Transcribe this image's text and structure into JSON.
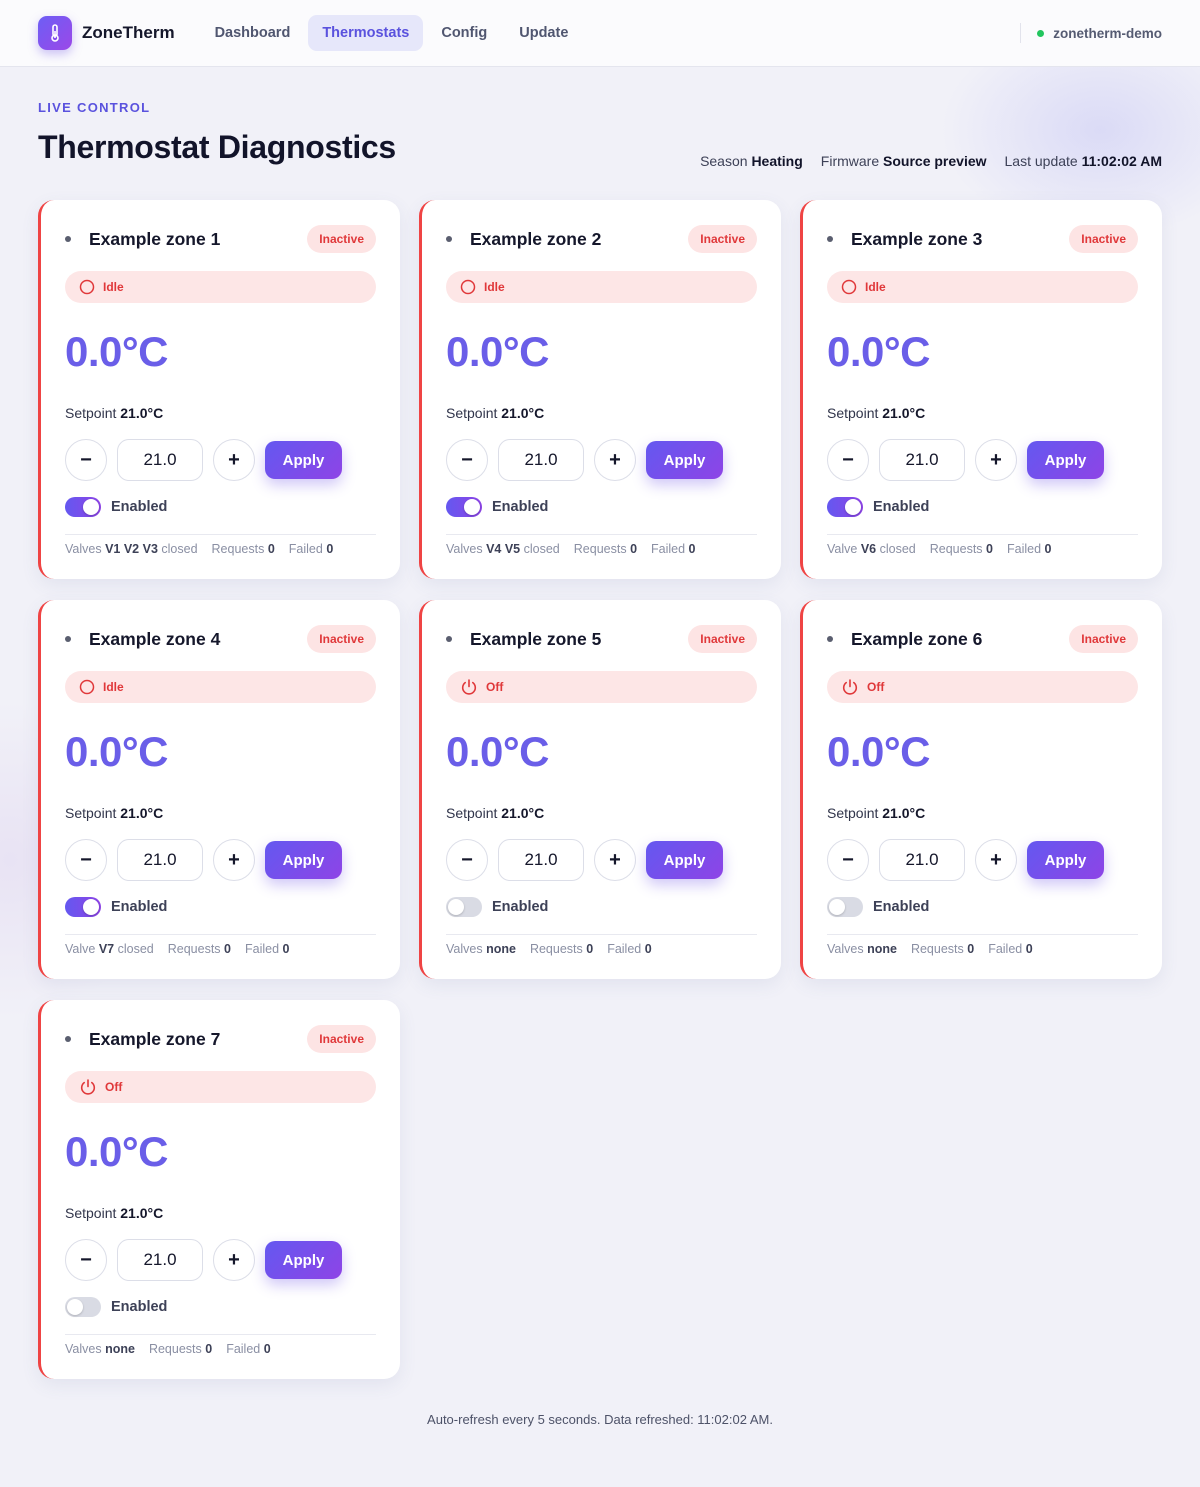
{
  "app": {
    "name": "ZoneTherm",
    "host": "zonetherm-demo"
  },
  "nav": [
    {
      "label": "Dashboard",
      "active": false
    },
    {
      "label": "Thermostats",
      "active": true
    },
    {
      "label": "Config",
      "active": false
    },
    {
      "label": "Update",
      "active": false
    }
  ],
  "page": {
    "eyebrow": "LIVE CONTROL",
    "title": "Thermostat Diagnostics",
    "meta": {
      "season_label": "Season",
      "season_value": "Heating",
      "firmware_label": "Firmware",
      "firmware_value": "Source preview",
      "update_label": "Last update",
      "update_value": "11:02:02 AM"
    }
  },
  "common": {
    "setpoint_label": "Setpoint",
    "apply_label": "Apply",
    "enabled_label": "Enabled",
    "requests_label": "Requests",
    "failed_label": "Failed",
    "minus_symbol": "−",
    "plus_symbol": "+"
  },
  "zones": [
    {
      "name": "Example zone 1",
      "badge": "Inactive",
      "state": "Idle",
      "state_icon": "idle-circle-icon",
      "temp": "0.0°C",
      "setpoint": "21.0°C",
      "input_value": "21.0",
      "enabled": true,
      "valves_label": "Valves",
      "valves": "V1 V2 V3",
      "valves_suffix": "closed",
      "requests": "0",
      "failed": "0"
    },
    {
      "name": "Example zone 2",
      "badge": "Inactive",
      "state": "Idle",
      "state_icon": "idle-circle-icon",
      "temp": "0.0°C",
      "setpoint": "21.0°C",
      "input_value": "21.0",
      "enabled": true,
      "valves_label": "Valves",
      "valves": "V4 V5",
      "valves_suffix": "closed",
      "requests": "0",
      "failed": "0"
    },
    {
      "name": "Example zone 3",
      "badge": "Inactive",
      "state": "Idle",
      "state_icon": "idle-circle-icon",
      "temp": "0.0°C",
      "setpoint": "21.0°C",
      "input_value": "21.0",
      "enabled": true,
      "valves_label": "Valve",
      "valves": "V6",
      "valves_suffix": "closed",
      "requests": "0",
      "failed": "0"
    },
    {
      "name": "Example zone 4",
      "badge": "Inactive",
      "state": "Idle",
      "state_icon": "idle-circle-icon",
      "temp": "0.0°C",
      "setpoint": "21.0°C",
      "input_value": "21.0",
      "enabled": true,
      "valves_label": "Valve",
      "valves": "V7",
      "valves_suffix": "closed",
      "requests": "0",
      "failed": "0"
    },
    {
      "name": "Example zone 5",
      "badge": "Inactive",
      "state": "Off",
      "state_icon": "power-icon",
      "temp": "0.0°C",
      "setpoint": "21.0°C",
      "input_value": "21.0",
      "enabled": false,
      "valves_label": "Valves",
      "valves": "none",
      "valves_suffix": "",
      "requests": "0",
      "failed": "0"
    },
    {
      "name": "Example zone 6",
      "badge": "Inactive",
      "state": "Off",
      "state_icon": "power-icon",
      "temp": "0.0°C",
      "setpoint": "21.0°C",
      "input_value": "21.0",
      "enabled": false,
      "valves_label": "Valves",
      "valves": "none",
      "valves_suffix": "",
      "requests": "0",
      "failed": "0"
    },
    {
      "name": "Example zone 7",
      "badge": "Inactive",
      "state": "Off",
      "state_icon": "power-icon",
      "temp": "0.0°C",
      "setpoint": "21.0°C",
      "input_value": "21.0",
      "enabled": false,
      "valves_label": "Valves",
      "valves": "none",
      "valves_suffix": "",
      "requests": "0",
      "failed": "0"
    }
  ],
  "footer": {
    "note": "Auto-refresh every 5 seconds. Data refreshed: 11:02:02 AM."
  },
  "colors": {
    "accent": "#6a5ee8",
    "inactive": "#e0383a",
    "online": "#22c55e"
  }
}
